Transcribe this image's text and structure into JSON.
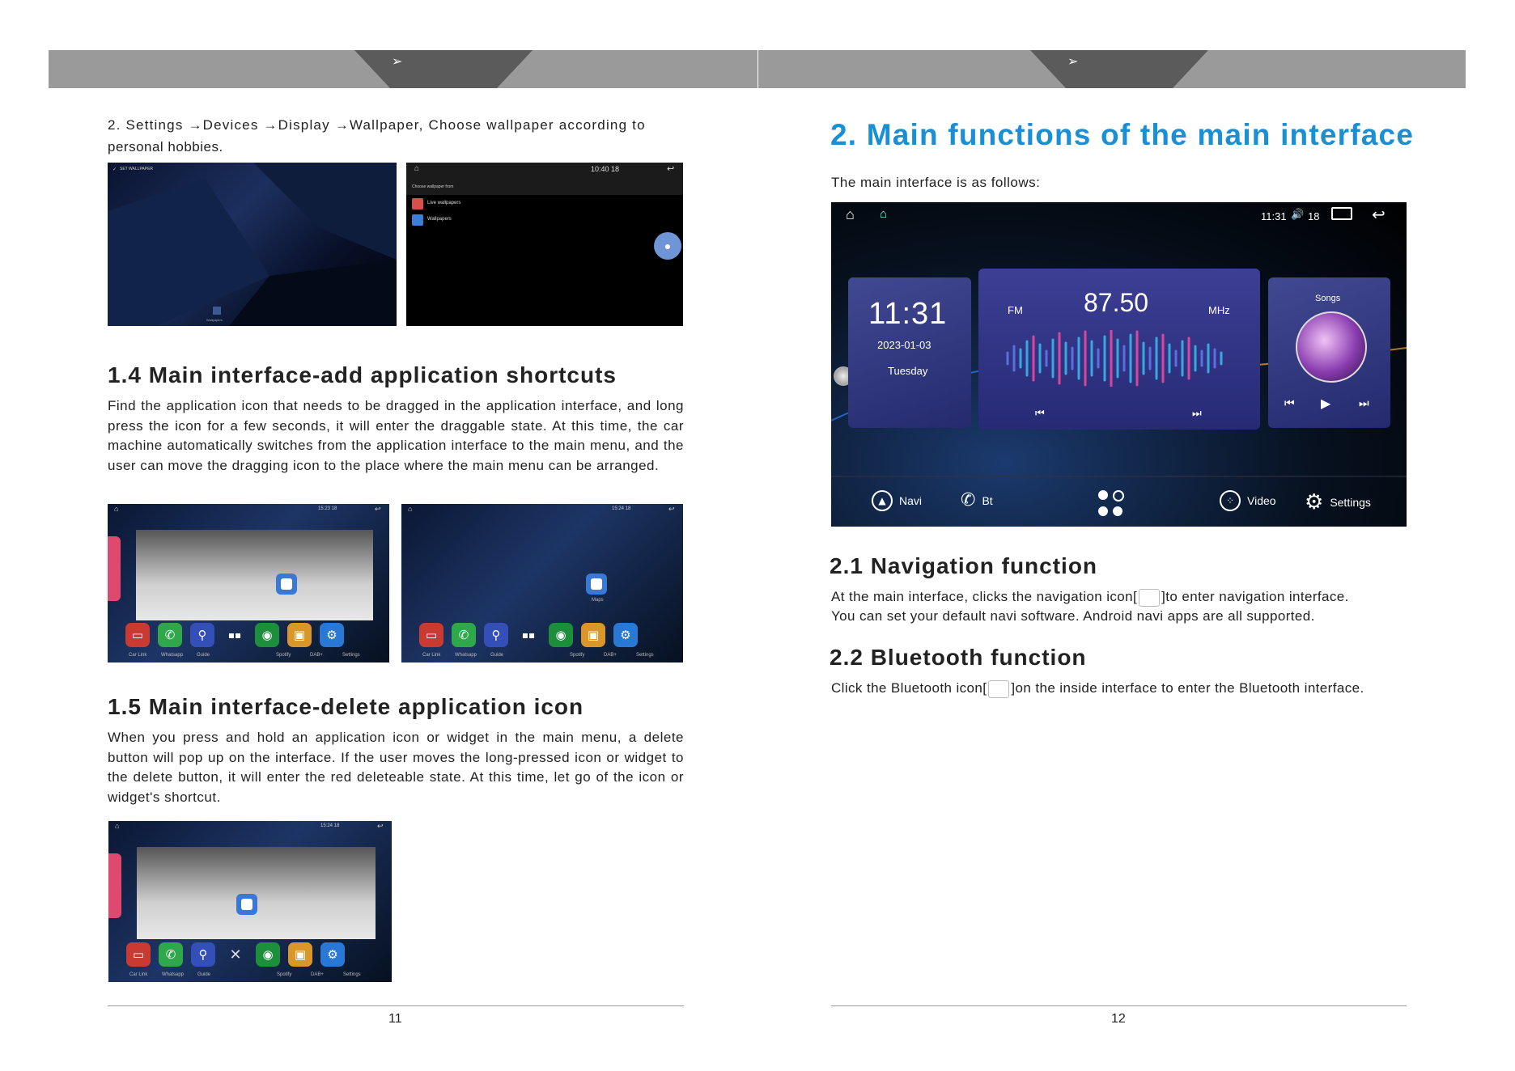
{
  "left_page": {
    "intro_line1": "2. Settings →Devices →Display →Wallpaper, Choose wallpaper according to",
    "intro_line2": "personal hobbies.",
    "shot1": {
      "label": "SET WALLPAPER",
      "wall_label": "Wallpapers"
    },
    "shot2": {
      "status": "10:40 18",
      "heading": "Choose wallpaper from",
      "opt1": "Live wallpapers",
      "opt2": "Wallpapers"
    },
    "s14_title": "1.4 Main interface-add application shortcuts",
    "s14_body": "Find the application icon that needs to be dragged in the application interface, and long press the icon for a few seconds, it will enter the draggable state. At this time, the car machine automatically switches from the application interface to the main menu, and the user can move the dragging icon to the place where the main menu can be arranged.",
    "dock_status_a": "15:23 18",
    "dock_status_b": "15:24 18",
    "maps_label": "Maps",
    "dock_apps": [
      "Car Link",
      "Whatsapp",
      "Guide",
      "",
      "Spotify",
      "DAB+",
      "Settings"
    ],
    "s15_title": "1.5 Main interface-delete application icon",
    "s15_body": "When you press and hold an application icon or widget in the main menu, a delete button will pop up on the interface. If the user moves the long-pressed icon or widget to the delete button, it will enter the red deleteable state. At this time, let go of the icon or widget's shortcut.",
    "page_number": "11"
  },
  "right_page": {
    "title": "2. Main functions of the main interface",
    "intro": "The main interface is as follows:",
    "main_ui": {
      "status_time": "11:31",
      "status_volume": "18",
      "clock": "11:31",
      "date": "2023-01-03",
      "weekday": "Tuesday",
      "band": "FM",
      "frequency": "87.50",
      "unit": "MHz",
      "music_title": "Songs",
      "nav": [
        "Navi",
        "Bt",
        "Video",
        "Settings"
      ]
    },
    "s21_title": "2.1 Navigation function",
    "s21_line1a": "At the main interface, clicks the navigation icon[",
    "s21_line1b": "]to enter navigation interface.",
    "s21_line2": "You can set your default navi software. Android navi apps are all supported.",
    "s22_title": "2.2 Bluetooth function",
    "s22_a": "Click the Bluetooth icon[",
    "s22_b": "]on the inside interface to enter the Bluetooth interface.",
    "page_number": "12"
  },
  "colors": {
    "title_blue": "#1a8fd6",
    "band_gray": "#9a9a9a",
    "band_dark": "#5b5b5b"
  }
}
